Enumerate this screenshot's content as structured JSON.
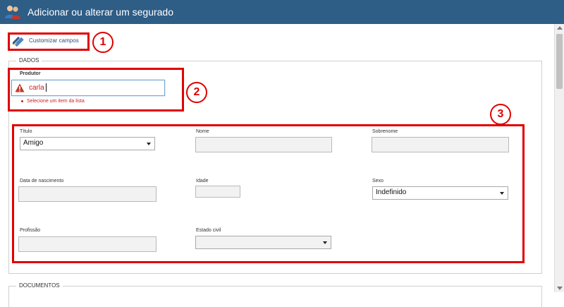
{
  "window": {
    "title": "Adicionar ou alterar um segurado"
  },
  "toolbar": {
    "customize_label": "Customizar campos"
  },
  "sections": {
    "dados": "DADOS",
    "documentos": "DOCUMENTOS"
  },
  "produtor": {
    "label": "Produtor",
    "value": "carla",
    "error": "Selecione um item da lista"
  },
  "form": {
    "titulo": {
      "label": "Título",
      "value": "Amigo"
    },
    "nome": {
      "label": "Nome",
      "value": ""
    },
    "sobrenome": {
      "label": "Sobrenome",
      "value": ""
    },
    "nascimento": {
      "label": "Data de nascimento",
      "value": ""
    },
    "idade": {
      "label": "Idade",
      "value": ""
    },
    "sexo": {
      "label": "Sexo",
      "value": "Indefinido"
    },
    "profissao": {
      "label": "Profissão",
      "value": ""
    },
    "estado_civil": {
      "label": "Estado civil",
      "value": ""
    }
  },
  "callouts": [
    "1",
    "2",
    "3"
  ],
  "colors": {
    "header": "#2e5d86",
    "annotation": "#e00000",
    "error": "#d21c1c",
    "input_bg": "#f2f2f2"
  },
  "icons": {
    "header": "users-icon",
    "customize": "pencil-ruler-icon",
    "warning": "warning-icon"
  }
}
